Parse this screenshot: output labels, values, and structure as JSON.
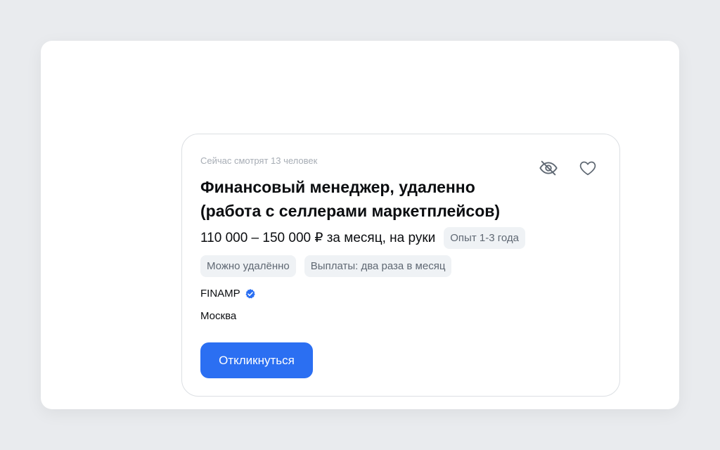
{
  "vacancy": {
    "viewers_text": "Сейчас смотрят 13 человек",
    "title_line1": "Финансовый менеджер, удаленно",
    "title_line2": "(работа с селлерами маркетплейсов)",
    "salary": "110 000 – 150 000 ₽ за месяц, на руки",
    "experience_tag": "Опыт 1-3 года",
    "tags": [
      "Можно удалённо",
      "Выплаты: два раза в месяц"
    ],
    "company": "FINAMP",
    "city": "Москва",
    "apply_label": "Откликнуться",
    "icons": {
      "hide": "eye-off-icon",
      "favorite": "heart-icon",
      "verified": "verified-badge-icon"
    }
  },
  "colors": {
    "accent": "#2b6ff2",
    "tag_bg": "#eff2f5",
    "muted_text": "#a7adb5",
    "page_bg": "#e9ebee"
  }
}
